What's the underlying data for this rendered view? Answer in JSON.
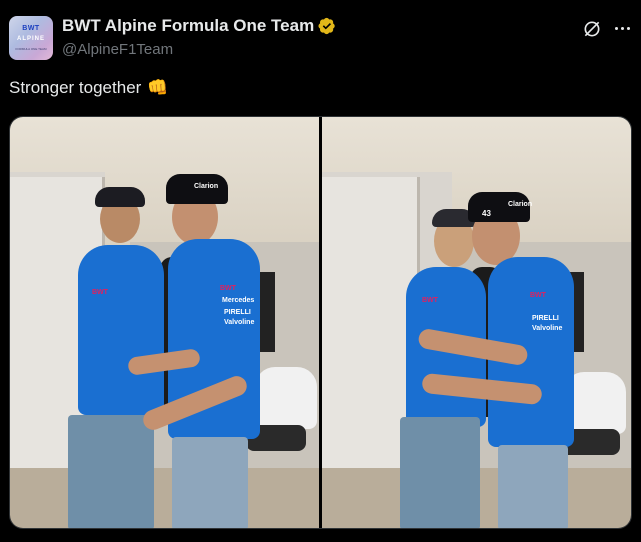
{
  "header": {
    "display_name": "BWT Alpine Formula One Team",
    "handle": "@AlpineF1Team",
    "avatar": {
      "brand": "BWT",
      "sub": "ALPINE",
      "tiny": "FORMULA ONE TEAM"
    }
  },
  "tweet": {
    "text": "Stronger together",
    "emoji": "👊"
  },
  "icons": {
    "verified": "verified-badge-icon",
    "grok": "grok-icon",
    "more": "more-options-icon"
  },
  "colors": {
    "background": "#000000",
    "text": "#e7e9ea",
    "secondary_text": "#71767b",
    "verified_gold": "#e2b719"
  },
  "media": {
    "photo1": {
      "sponsor": "BWT",
      "cap_logo": "Clarion",
      "sponsors_small": [
        "BWT",
        "Mercedes",
        "PIRELLI",
        "Valvoline"
      ]
    },
    "photo2": {
      "sponsor": "BWT",
      "cap_logo": "Clarion",
      "cap_number": "43",
      "sponsors_small": [
        "BWT",
        "PIRELLI",
        "Valvoline"
      ]
    }
  }
}
